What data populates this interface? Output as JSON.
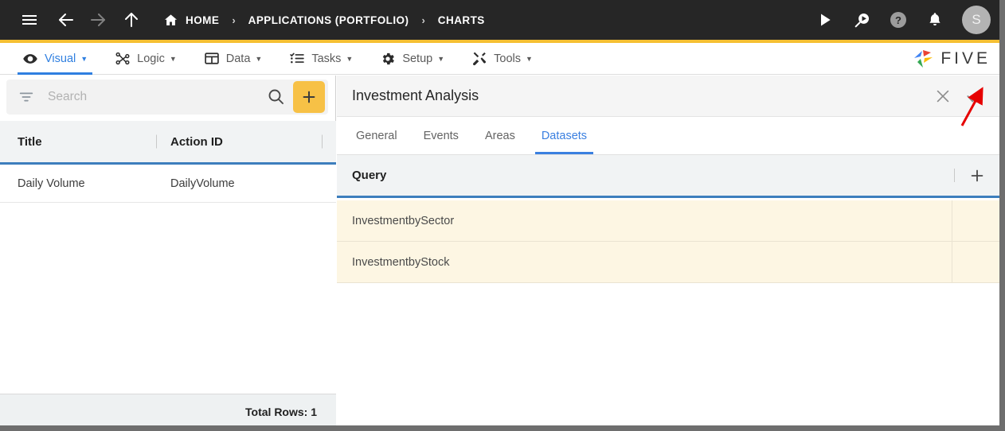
{
  "topbar": {
    "icons": {
      "menu": "hamburger-icon",
      "back": "arrow-back-icon",
      "forward": "arrow-forward-icon",
      "up": "arrow-up-icon",
      "home": "home-icon",
      "run": "play-icon",
      "search_run": "search-play-icon",
      "help": "help-circle-icon",
      "notifications": "bell-icon"
    },
    "breadcrumbs": [
      {
        "label": "HOME"
      },
      {
        "label": "APPLICATIONS (PORTFOLIO)"
      },
      {
        "label": "CHARTS"
      }
    ],
    "separator": "›",
    "avatar_initial": "S",
    "bar_color": "#262626",
    "accent_color": "#f5c033"
  },
  "menubar": {
    "items": [
      {
        "label": "Visual",
        "icon": "eye-icon",
        "caret": "▼",
        "active": true
      },
      {
        "label": "Logic",
        "icon": "logic-nodes-icon",
        "caret": "▼",
        "active": false
      },
      {
        "label": "Data",
        "icon": "table-grid-icon",
        "caret": "▼",
        "active": false
      },
      {
        "label": "Tasks",
        "icon": "checklist-icon",
        "caret": "▼",
        "active": false
      },
      {
        "label": "Setup",
        "icon": "gear-icon",
        "caret": "▼",
        "active": false
      },
      {
        "label": "Tools",
        "icon": "tools-icon",
        "caret": "▼",
        "active": false
      }
    ],
    "brand": "FIVE",
    "active_color": "#2f7fe0"
  },
  "left_panel": {
    "search": {
      "placeholder": "Search",
      "value": "",
      "filter_icon": "filter-icon",
      "search_icon": "magnifier-icon",
      "add_label": "+"
    },
    "table": {
      "columns": [
        "Title",
        "Action ID"
      ],
      "rows": [
        {
          "title": "Daily Volume",
          "action_id": "DailyVolume"
        }
      ]
    },
    "footer": {
      "total_rows": "Total Rows: 1"
    }
  },
  "right_panel": {
    "title": "Investment Analysis",
    "actions": {
      "close": "close-icon",
      "confirm": "check-icon"
    },
    "tabs": [
      {
        "label": "General",
        "active": false
      },
      {
        "label": "Events",
        "active": false
      },
      {
        "label": "Areas",
        "active": false
      },
      {
        "label": "Datasets",
        "active": true
      }
    ],
    "grid": {
      "column_header": "Query",
      "add_label": "+",
      "rows": [
        {
          "query": "InvestmentbySector"
        },
        {
          "query": "InvestmentbyStock"
        }
      ],
      "row_background": "#fdf6e3",
      "header_underline": "#3d7ebd"
    }
  },
  "annotation": {
    "arrow_color": "#e60000",
    "points_to": "check-icon"
  }
}
